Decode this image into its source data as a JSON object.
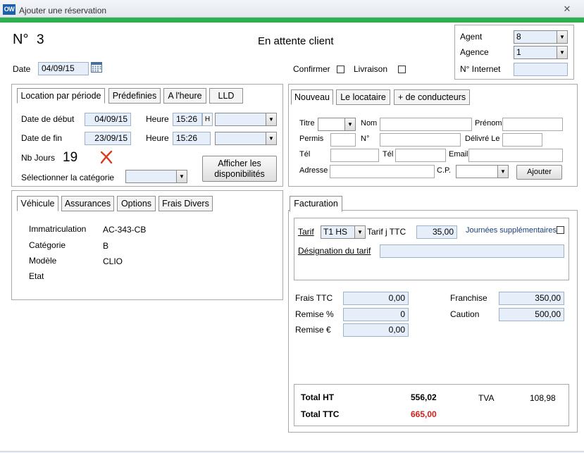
{
  "window": {
    "title": "Ajouter une réservation",
    "app_logo": "OW",
    "close_glyph": "✕"
  },
  "header": {
    "number_label": "N°",
    "number_value": "3",
    "status": "En attente client",
    "date_label": "Date",
    "date_value": "04/09/15",
    "confirmer_label": "Confirmer",
    "livraison_label": "Livraison"
  },
  "agent_panel": {
    "agent_label": "Agent",
    "agent_value": "8",
    "agence_label": "Agence",
    "agence_value": "1",
    "internet_label": "N° Internet",
    "internet_value": ""
  },
  "rental": {
    "tabs": [
      "Location par période",
      "Prédefinies",
      "A l'heure",
      "LLD"
    ],
    "start_label": "Date de début",
    "start_value": "04/09/15",
    "heure_label": "Heure",
    "start_time": "15:26",
    "h_button": "H",
    "end_label": "Date de fin",
    "end_value": "23/09/15",
    "end_time": "15:26",
    "nb_jours_label": "Nb Jours",
    "nb_jours_value": "19",
    "category_label": "Sélectionner la catégorie",
    "availability_button_line1": "Afficher les",
    "availability_button_line2": "disponibilités"
  },
  "vehicle": {
    "tabs": [
      "Véhicule",
      "Assurances",
      "Options",
      "Frais Divers"
    ],
    "rows": [
      {
        "label": "Immatriculation",
        "value": "AC-343-CB"
      },
      {
        "label": "Catégorie",
        "value": "B"
      },
      {
        "label": "Modèle",
        "value": "CLIO"
      },
      {
        "label": "Etat",
        "value": ""
      }
    ]
  },
  "client": {
    "tabs": [
      "Nouveau",
      "Le locataire",
      "+ de conducteurs"
    ],
    "titre_label": "Titre",
    "nom_label": "Nom",
    "prenom_label": "Prénom",
    "permis_label": "Permis",
    "no_label": "N°",
    "delivre_label": "Délivré Le",
    "tel1_label": "Tél",
    "tel2_label": "Tél",
    "email_label": "Email",
    "adresse_label": "Adresse",
    "cp_label": "C.P.",
    "ajouter_button": "Ajouter"
  },
  "billing": {
    "tab": "Facturation",
    "tarif_label": "Tarif",
    "tarif_value": "T1 HS",
    "tarif_j_label": "Tarif j TTC",
    "tarif_j_value": "35,00",
    "jours_sup_label": "Journées supplémentaires",
    "designation_label": "Désignation du tarif",
    "designation_value": "",
    "frais_label": "Frais TTC",
    "frais_value": "0,00",
    "remise_pct_label": "Remise %",
    "remise_pct_value": "0",
    "remise_eur_label": "Remise  €",
    "remise_eur_value": "0,00",
    "franchise_label": "Franchise",
    "franchise_value": "350,00",
    "caution_label": "Caution",
    "caution_value": "500,00",
    "total_ht_label": "Total HT",
    "total_ht_value": "556,02",
    "tva_label": "TVA",
    "tva_value": "108,98",
    "total_ttc_label": "Total TTC",
    "total_ttc_value": "665,00"
  },
  "colors": {
    "accent_bar": "#2db14f",
    "field_bg": "#e6eefa",
    "total_ttc": "#d0201e",
    "cancel_x": "#d9391f"
  }
}
